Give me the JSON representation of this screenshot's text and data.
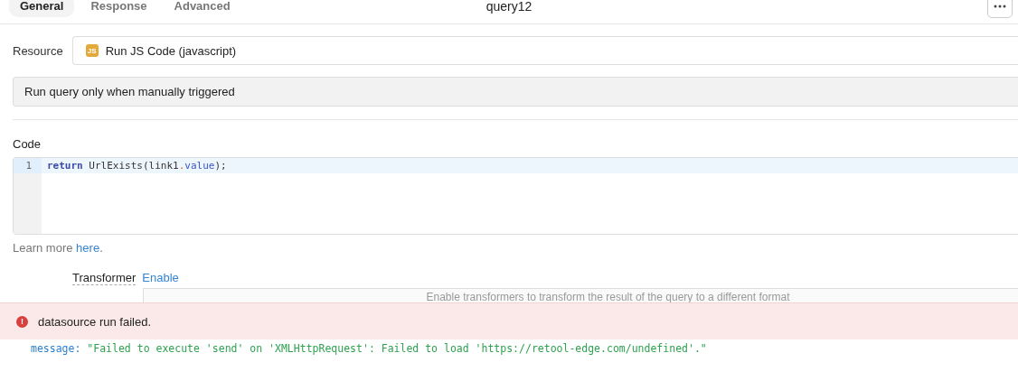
{
  "tabs": [
    {
      "label": "General",
      "selected": true
    },
    {
      "label": "Response",
      "selected": false
    },
    {
      "label": "Advanced",
      "selected": false
    }
  ],
  "query_name": "query12",
  "resource": {
    "label": "Resource",
    "badge": "JS",
    "value": "Run JS Code (javascript)"
  },
  "trigger": {
    "value": "Run query only when manually triggered"
  },
  "code": {
    "label": "Code",
    "lines": [
      {
        "number": "1",
        "tokens": [
          {
            "kind": "keyword",
            "text": "return"
          },
          {
            "kind": "plain",
            "text": " UrlExists(link1"
          },
          {
            "kind": "punct",
            "text": "."
          },
          {
            "kind": "prop",
            "text": "value"
          },
          {
            "kind": "plain",
            "text": ");"
          }
        ]
      }
    ]
  },
  "learn_more": {
    "text": "Learn more ",
    "link": "here",
    "end": "."
  },
  "transformer": {
    "label": "Transformer",
    "action": "Enable",
    "hint": "Enable transformers to transform the result of the query to a different format"
  },
  "error": {
    "icon": "!",
    "message": "datasource run failed."
  },
  "detail": {
    "key": "message:",
    "value": "\"Failed to execute 'send' on 'XMLHttpRequest': Failed to load 'https://retool-edge.com/undefined'.\""
  }
}
